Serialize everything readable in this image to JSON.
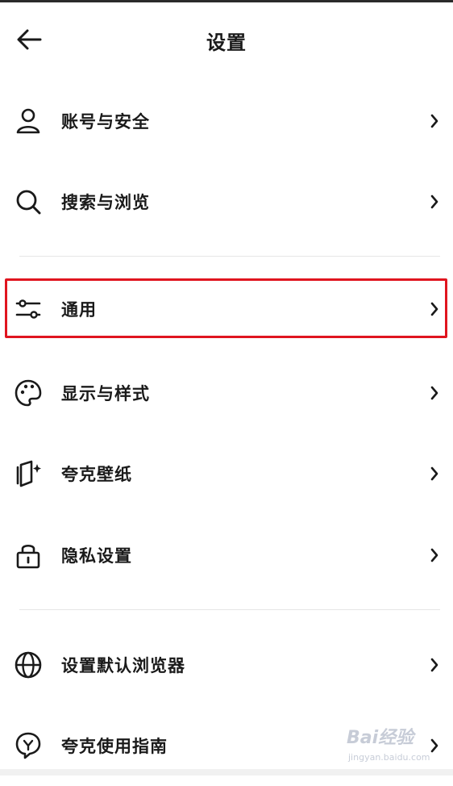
{
  "header": {
    "title": "设置"
  },
  "items": [
    {
      "label": "账号与安全",
      "icon": "user-icon"
    },
    {
      "label": "搜索与浏览",
      "icon": "search-icon"
    },
    {
      "label": "通用",
      "icon": "sliders-icon"
    },
    {
      "label": "显示与样式",
      "icon": "palette-icon"
    },
    {
      "label": "夸克壁纸",
      "icon": "wallpaper-sparkle-icon"
    },
    {
      "label": "隐私设置",
      "icon": "lock-icon"
    },
    {
      "label": "设置默认浏览器",
      "icon": "globe-icon"
    },
    {
      "label": "夸克使用指南",
      "icon": "guide-bulb-icon"
    }
  ],
  "colors": {
    "highlight": "#e0151f",
    "text": "#1a1a1a",
    "divider": "#e6e6e6"
  },
  "watermark": {
    "main": "Bai经验",
    "sub": "jingyan.baidu.com"
  }
}
